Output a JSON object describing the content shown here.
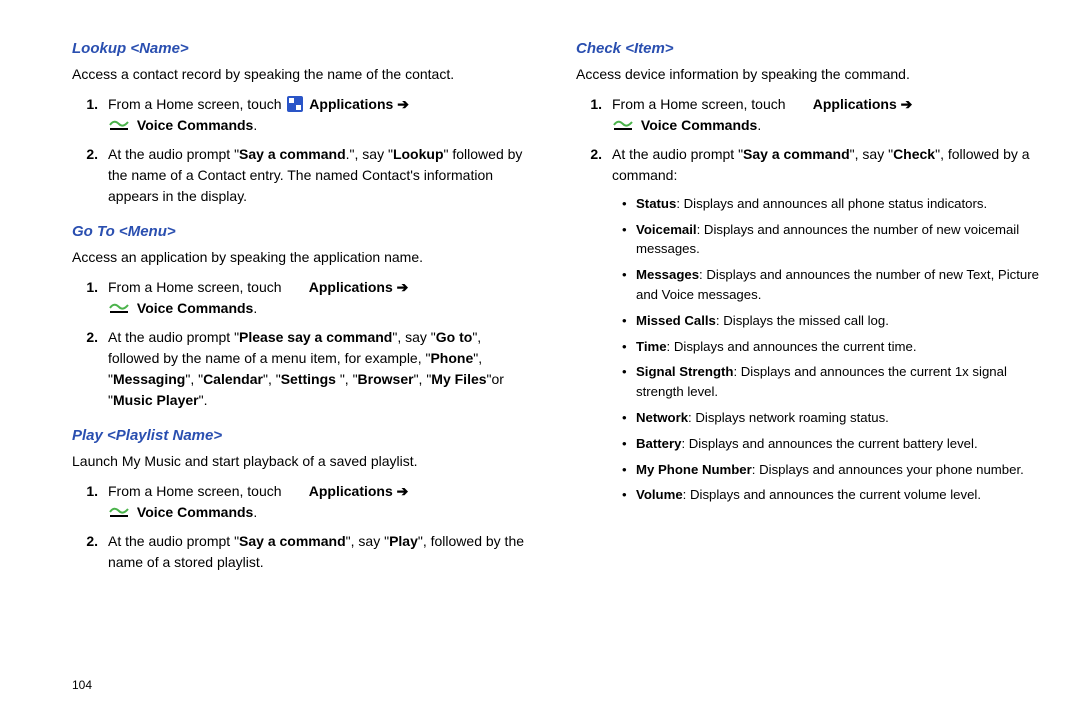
{
  "pageNumber": "104",
  "arrow": "➔",
  "common": {
    "fromHomePrefix": "From a Home screen, touch ",
    "applications": "Applications",
    "voiceCommands": "Voice Commands",
    "period": "."
  },
  "left": {
    "lookup": {
      "title": "Lookup <Name>",
      "desc": "Access a contact record by speaking the name of the contact.",
      "step2": "At the audio prompt \"",
      "sayCmd": "Say a command",
      "step2b": ".\", say \"",
      "lookup": "Lookup",
      "step2c": "\" followed by the name of a Contact entry. The named Contact's information appears in the display."
    },
    "goto": {
      "title": "Go To <Menu>",
      "desc": "Access an application by speaking the application name.",
      "step2a": "At the audio prompt \"",
      "pleaseSay": "Please say a command",
      "step2b": "\", say \"",
      "goTo": "Go to",
      "step2c": "\", followed by the name of a menu item, for example, \"",
      "phone": "Phone",
      "messaging": "Messaging",
      "calendar": "Calendar",
      "settings": "Settings",
      "browser": "Browser",
      "myFiles": "My Files",
      "or": "\"or \"",
      "musicPlayer": "Music Player",
      "midSep": "\", \"",
      "spaceQuote": " \", \"",
      "end": "\"."
    },
    "play": {
      "title": "Play <Playlist Name>",
      "desc": "Launch My Music and start playback of a saved playlist.",
      "step2a": "At the audio prompt \"",
      "sayCmd": "Say a command",
      "step2b": "\", say \"",
      "play": "Play",
      "step2c": "\", followed by the name of a stored playlist."
    }
  },
  "right": {
    "check": {
      "title": "Check <Item>",
      "desc": "Access device information by speaking the command.",
      "step2a": "At the audio prompt \"",
      "sayCmd": "Say a command",
      "step2b": "\", say \"",
      "check": "Check",
      "step2c": "\", followed by a command:",
      "bullets": [
        {
          "label": "Status",
          "text": ": Displays and announces all phone status indicators."
        },
        {
          "label": "Voicemail",
          "text": ": Displays and announces the number of new voicemail messages."
        },
        {
          "label": "Messages",
          "text": ": Displays and announces the number of new Text, Picture and Voice messages."
        },
        {
          "label": "Missed Calls",
          "text": ": Displays the missed call log."
        },
        {
          "label": "Time",
          "text": ": Displays and announces the current time."
        },
        {
          "label": "Signal Strength",
          "text": ": Displays and announces the current 1x signal strength level."
        },
        {
          "label": "Network",
          "text": ": Displays network roaming status."
        },
        {
          "label": "Battery",
          "text": ": Displays and announces the current battery level."
        },
        {
          "label": "My Phone Number",
          "text": ": Displays and announces your phone number."
        },
        {
          "label": "Volume",
          "text": ": Displays and announces the current volume level."
        }
      ]
    }
  }
}
